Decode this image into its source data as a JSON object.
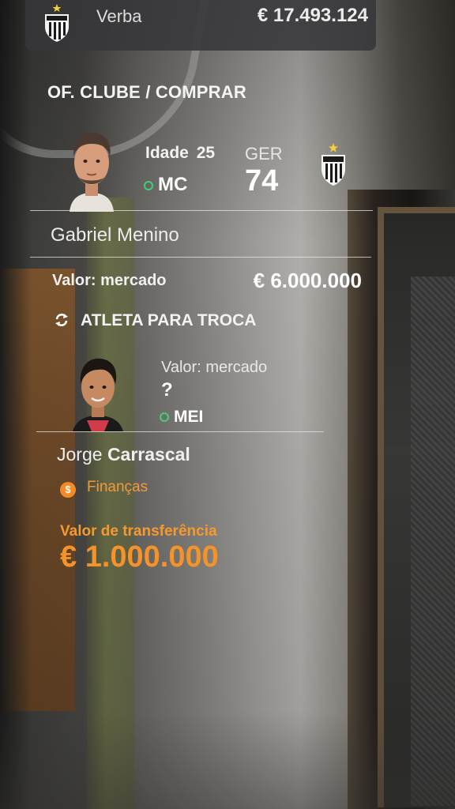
{
  "header": {
    "budget_label": "Verba",
    "budget_value": "€ 17.493.124",
    "crest_icon": "club-crest-icon"
  },
  "section": {
    "title": "OF. CLUBE / COMPRAR"
  },
  "target_player": {
    "age_label": "Idade",
    "age_value": "25",
    "position": "MC",
    "rating_label": "GER",
    "rating_value": "74",
    "name": "Gabriel Menino",
    "market_label": "Valor: mercado",
    "market_value": "€ 6.000.000"
  },
  "exchange": {
    "label": "ATLETA PARA TROCA",
    "icon": "swap-icon",
    "market_label": "Valor: mercado",
    "market_value": "?",
    "position": "MEI",
    "first_name": "Jorge",
    "last_name": "Carrascal"
  },
  "finance": {
    "label": "Finanças",
    "icon": "finance-icon"
  },
  "transfer": {
    "label": "Valor de transferência",
    "value": "€ 1.000.000"
  },
  "colors": {
    "accent_orange": "#f5922a",
    "position_dot": "#3fd07a"
  }
}
